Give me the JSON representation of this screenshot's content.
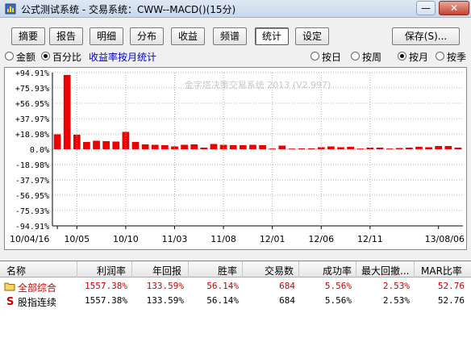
{
  "window": {
    "title": "公式测试系统 - 交易系统：CWW--MACD()(15分)",
    "min_label": "—",
    "close_label": "✕"
  },
  "toolbar": {
    "tabs": [
      {
        "label": "摘要"
      },
      {
        "label": "报告"
      },
      {
        "label": "明细"
      },
      {
        "label": "分布"
      },
      {
        "label": "收益"
      },
      {
        "label": "频谱"
      },
      {
        "label": "统计"
      },
      {
        "label": "设定"
      }
    ],
    "active_tab": "统计",
    "save_label": "保存(S)..."
  },
  "options": {
    "amount_label": "金额",
    "percent_label": "百分比",
    "stat_caption": "收益率按月统计",
    "period_day": "按日",
    "period_week": "按周",
    "period_month": "按月",
    "period_quarter": "按季",
    "selected_mode": "百分比",
    "selected_period": "按月"
  },
  "chart_data": {
    "type": "bar",
    "watermark": "金字塔决策交易系统 2013 (V2.997)",
    "y_ticks": [
      "+94.91%",
      "+75.93%",
      "+56.95%",
      "+37.97%",
      "+18.98%",
      "0.0%",
      "-18.98%",
      "-37.97%",
      "-56.95%",
      "-75.93%",
      "-94.91%"
    ],
    "ylim": [
      -94.91,
      94.91
    ],
    "x_labels": [
      "10/04/16",
      "10/05",
      "10/10",
      "11/03",
      "11/08",
      "12/01",
      "12/06",
      "12/11",
      "13/08/06"
    ],
    "x_label_positions": [
      0,
      2,
      7,
      12,
      17,
      22,
      27,
      32,
      39
    ],
    "bar_color": "#ee0000",
    "values": [
      18.5,
      92.0,
      18.0,
      9.0,
      10.5,
      10.0,
      9.5,
      21.5,
      9.0,
      6.0,
      5.5,
      5.0,
      3.5,
      5.5,
      6.0,
      2.0,
      6.5,
      5.5,
      5.0,
      5.0,
      5.5,
      5.0,
      0.8,
      4.5,
      0.8,
      1.0,
      1.0,
      2.5,
      3.5,
      2.5,
      3.0,
      0.8,
      2.0,
      2.0,
      0.8,
      1.5,
      2.0,
      3.0,
      2.5,
      4.0,
      4.0,
      2.0
    ]
  },
  "table": {
    "headers": [
      "名称",
      "利润率",
      "年回报",
      "胜率",
      "交易数",
      "成功率",
      "最大回撤...",
      "MAR比率"
    ],
    "rows": [
      {
        "name": "全部综合",
        "icon": "folder-icon",
        "values": [
          "1557.38%",
          "133.59%",
          "56.14%",
          "684",
          "5.56%",
          "2.53%",
          "52.76"
        ],
        "red": true
      },
      {
        "name": "股指连续",
        "icon": "s-icon",
        "values": [
          "1557.38%",
          "133.59%",
          "56.14%",
          "684",
          "5.56%",
          "2.53%",
          "52.76"
        ],
        "red": false
      }
    ]
  }
}
